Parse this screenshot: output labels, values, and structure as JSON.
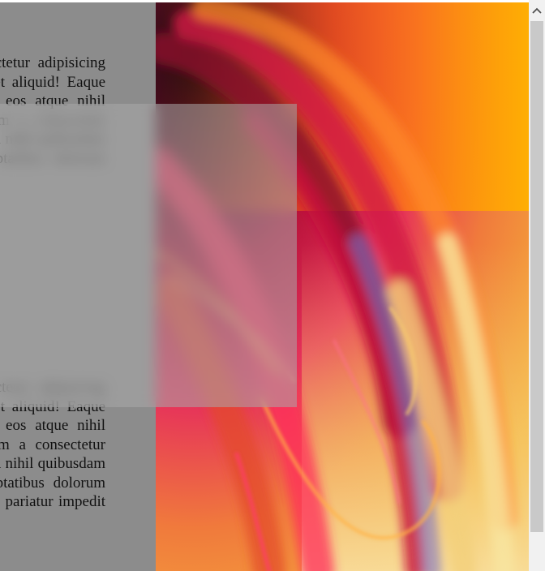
{
  "content": {
    "paragraph_top": "Lorem ipsum dolor sit amet consectetur adipisicing elit. Quo earum impedit inventore et aliquid! Eaque iusto nobis at adipisci ex laborum eos atque nihil numquam cum voluptatibus dolorum a consectetur sequi illum illo fugit blanditiis aliquid nihil quibusdam mollitia ipsum laborum. Eius voluptatibus dolorum saepe consequatur dolorem reiciendis",
    "paragraph_bottom": "Lorem ipsum dolor sit amet consectetur adipisicing elit. Quo earum impedit inventore et aliquid! Eaque iusto nobis at adipisci ex laborum eos atque nihil numquam cum voluptatibus dolorum a consectetur sequi illum illo fugit blanditiis aliquid nihil quibusdam mollitia ipsum laborum. Eius voluptatibus dolorum saepe consequatur dolorem reiciendis pariatur impedit molestiae"
  },
  "image": {
    "icon": "abstract-colorful-image"
  },
  "scrollbar": {
    "up_icon": "chevron-up-icon"
  },
  "colors": {
    "text_column_bg": "#8c8c8c",
    "overlay": "rgba(170,170,170,0.55)",
    "scroll_thumb": "#c9c9c9",
    "scroll_track": "#f1f1f1"
  }
}
